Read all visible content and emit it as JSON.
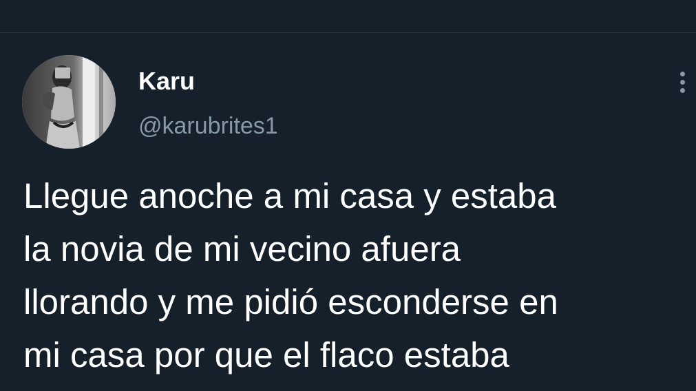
{
  "tweet": {
    "author": {
      "display_name": "Karu",
      "handle": "@karubrites1",
      "avatar_icon": "profile-photo"
    },
    "more_icon": "more-options-icon",
    "text_lines": [
      "Llegue anoche a mi casa y estaba",
      "la novia de mi vecino afuera",
      "llorando y me pidió esconderse en",
      "mi casa por que el flaco estaba"
    ]
  },
  "colors": {
    "background": "#15202b",
    "primary_text": "#ffffff",
    "secondary_text": "#8899a6",
    "divider": "#2b3a48"
  }
}
